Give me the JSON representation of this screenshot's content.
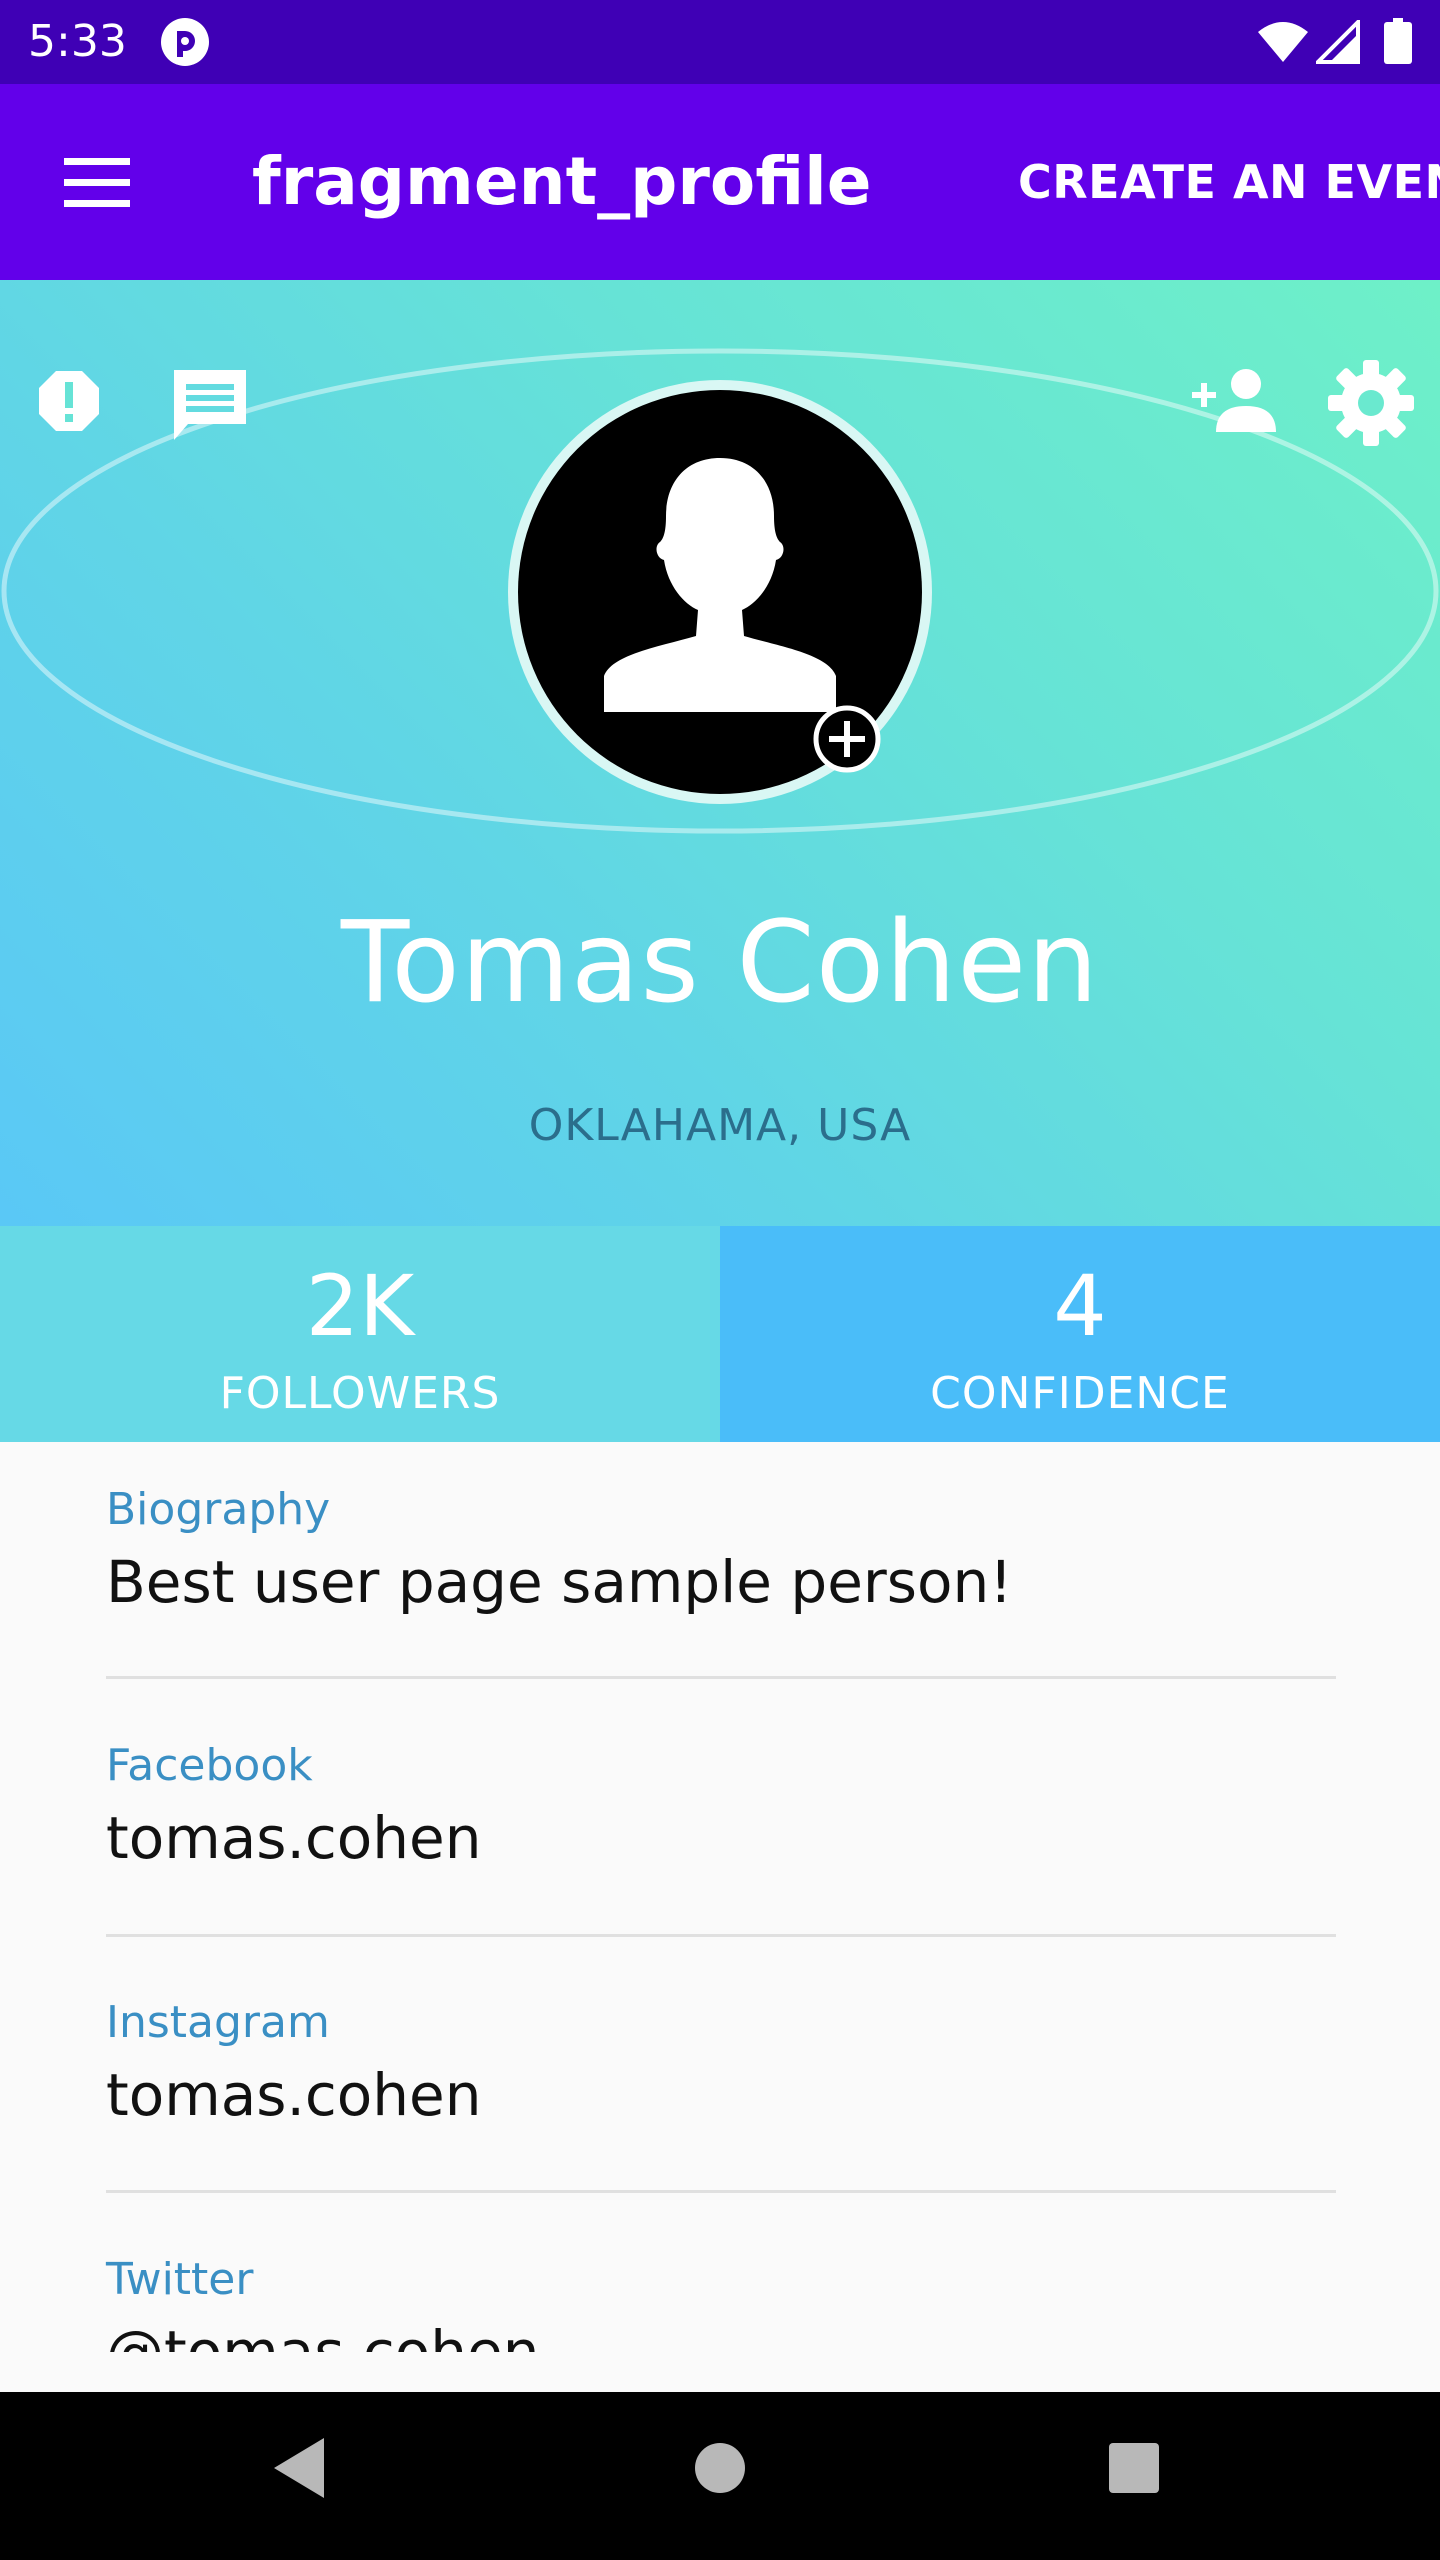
{
  "status_bar": {
    "time": "5:33",
    "icons": [
      "app-notification-icon",
      "wifi-icon",
      "cell-signal-icon",
      "battery-icon"
    ]
  },
  "toolbar": {
    "title": "fragment_profile",
    "action_label": "CREATE AN EVENT",
    "icons": [
      "menu-icon"
    ]
  },
  "profile": {
    "name": "Tomas Cohen",
    "location": "OKLAHAMA, USA",
    "header_icons": [
      "alert-icon",
      "chat-icon",
      "add-person-icon",
      "settings-icon",
      "add-photo-icon"
    ]
  },
  "stats": [
    {
      "value": "2K",
      "label": "FOLLOWERS"
    },
    {
      "value": "4",
      "label": "CONFIDENCE"
    }
  ],
  "details": [
    {
      "label": "Biography",
      "value": "Best user page sample person!"
    },
    {
      "label": "Facebook",
      "value": "tomas.cohen"
    },
    {
      "label": "Instagram",
      "value": "tomas.cohen"
    },
    {
      "label": "Twitter",
      "value": "@tomas.cohen"
    }
  ],
  "nav_bar": {
    "icons": [
      "back-icon",
      "home-icon",
      "recents-icon"
    ]
  },
  "colors": {
    "status_bar": "#3f00b5",
    "toolbar": "#6200ea",
    "header_gradient_start": "#5ac8f6",
    "header_gradient_end": "#6ef0c8",
    "followers_bg": "#66d9e6",
    "confidence_bg": "#4abdf9",
    "detail_label": "#3a8fc4",
    "location_text": "#2b6e8c"
  }
}
